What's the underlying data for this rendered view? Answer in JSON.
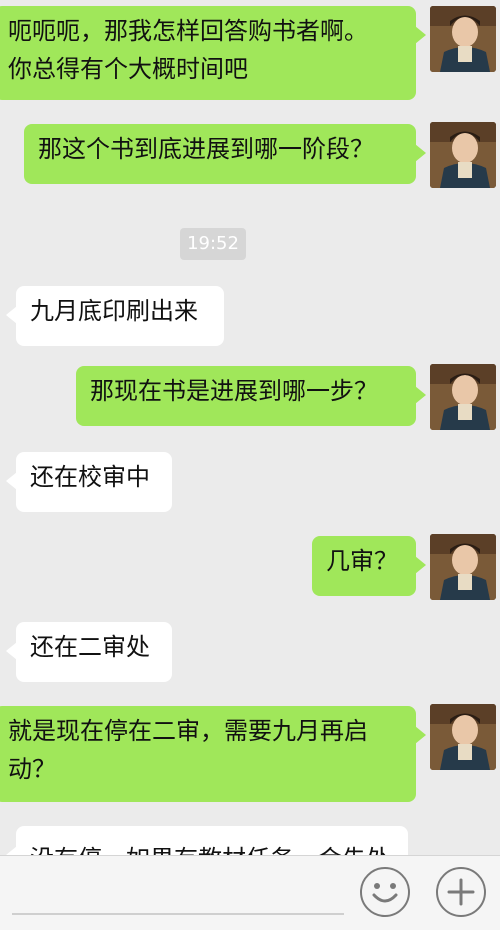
{
  "messages": [
    {
      "side": "out",
      "lines": [
        "呃呃呃，那我怎样回答购书者啊。",
        "你总得有个大概时间吧"
      ]
    },
    {
      "side": "out",
      "lines": [
        "那这个书到底进展到哪一阶段？"
      ]
    },
    {
      "side": "in",
      "lines": [
        "九月底印刷出来"
      ]
    },
    {
      "side": "out",
      "lines": [
        "那现在书是进展到哪一步？"
      ]
    },
    {
      "side": "in",
      "lines": [
        "还在校审中"
      ]
    },
    {
      "side": "out",
      "lines": [
        "几审？"
      ]
    },
    {
      "side": "in",
      "lines": [
        "还在二审处"
      ]
    },
    {
      "side": "out",
      "lines": [
        "就是现在停在二审，需要九月再启",
        "动？"
      ]
    },
    {
      "side": "in",
      "lines": [
        "没有停，如果有教材任务，会先处"
      ]
    }
  ],
  "timestamp": "19:52",
  "input_bar": {
    "emoji_icon": "smiley-icon",
    "add_icon": "plus-icon"
  },
  "colors": {
    "outgoing_bubble": "#a0e75a",
    "incoming_bubble": "#ffffff",
    "background": "#ebebeb"
  }
}
